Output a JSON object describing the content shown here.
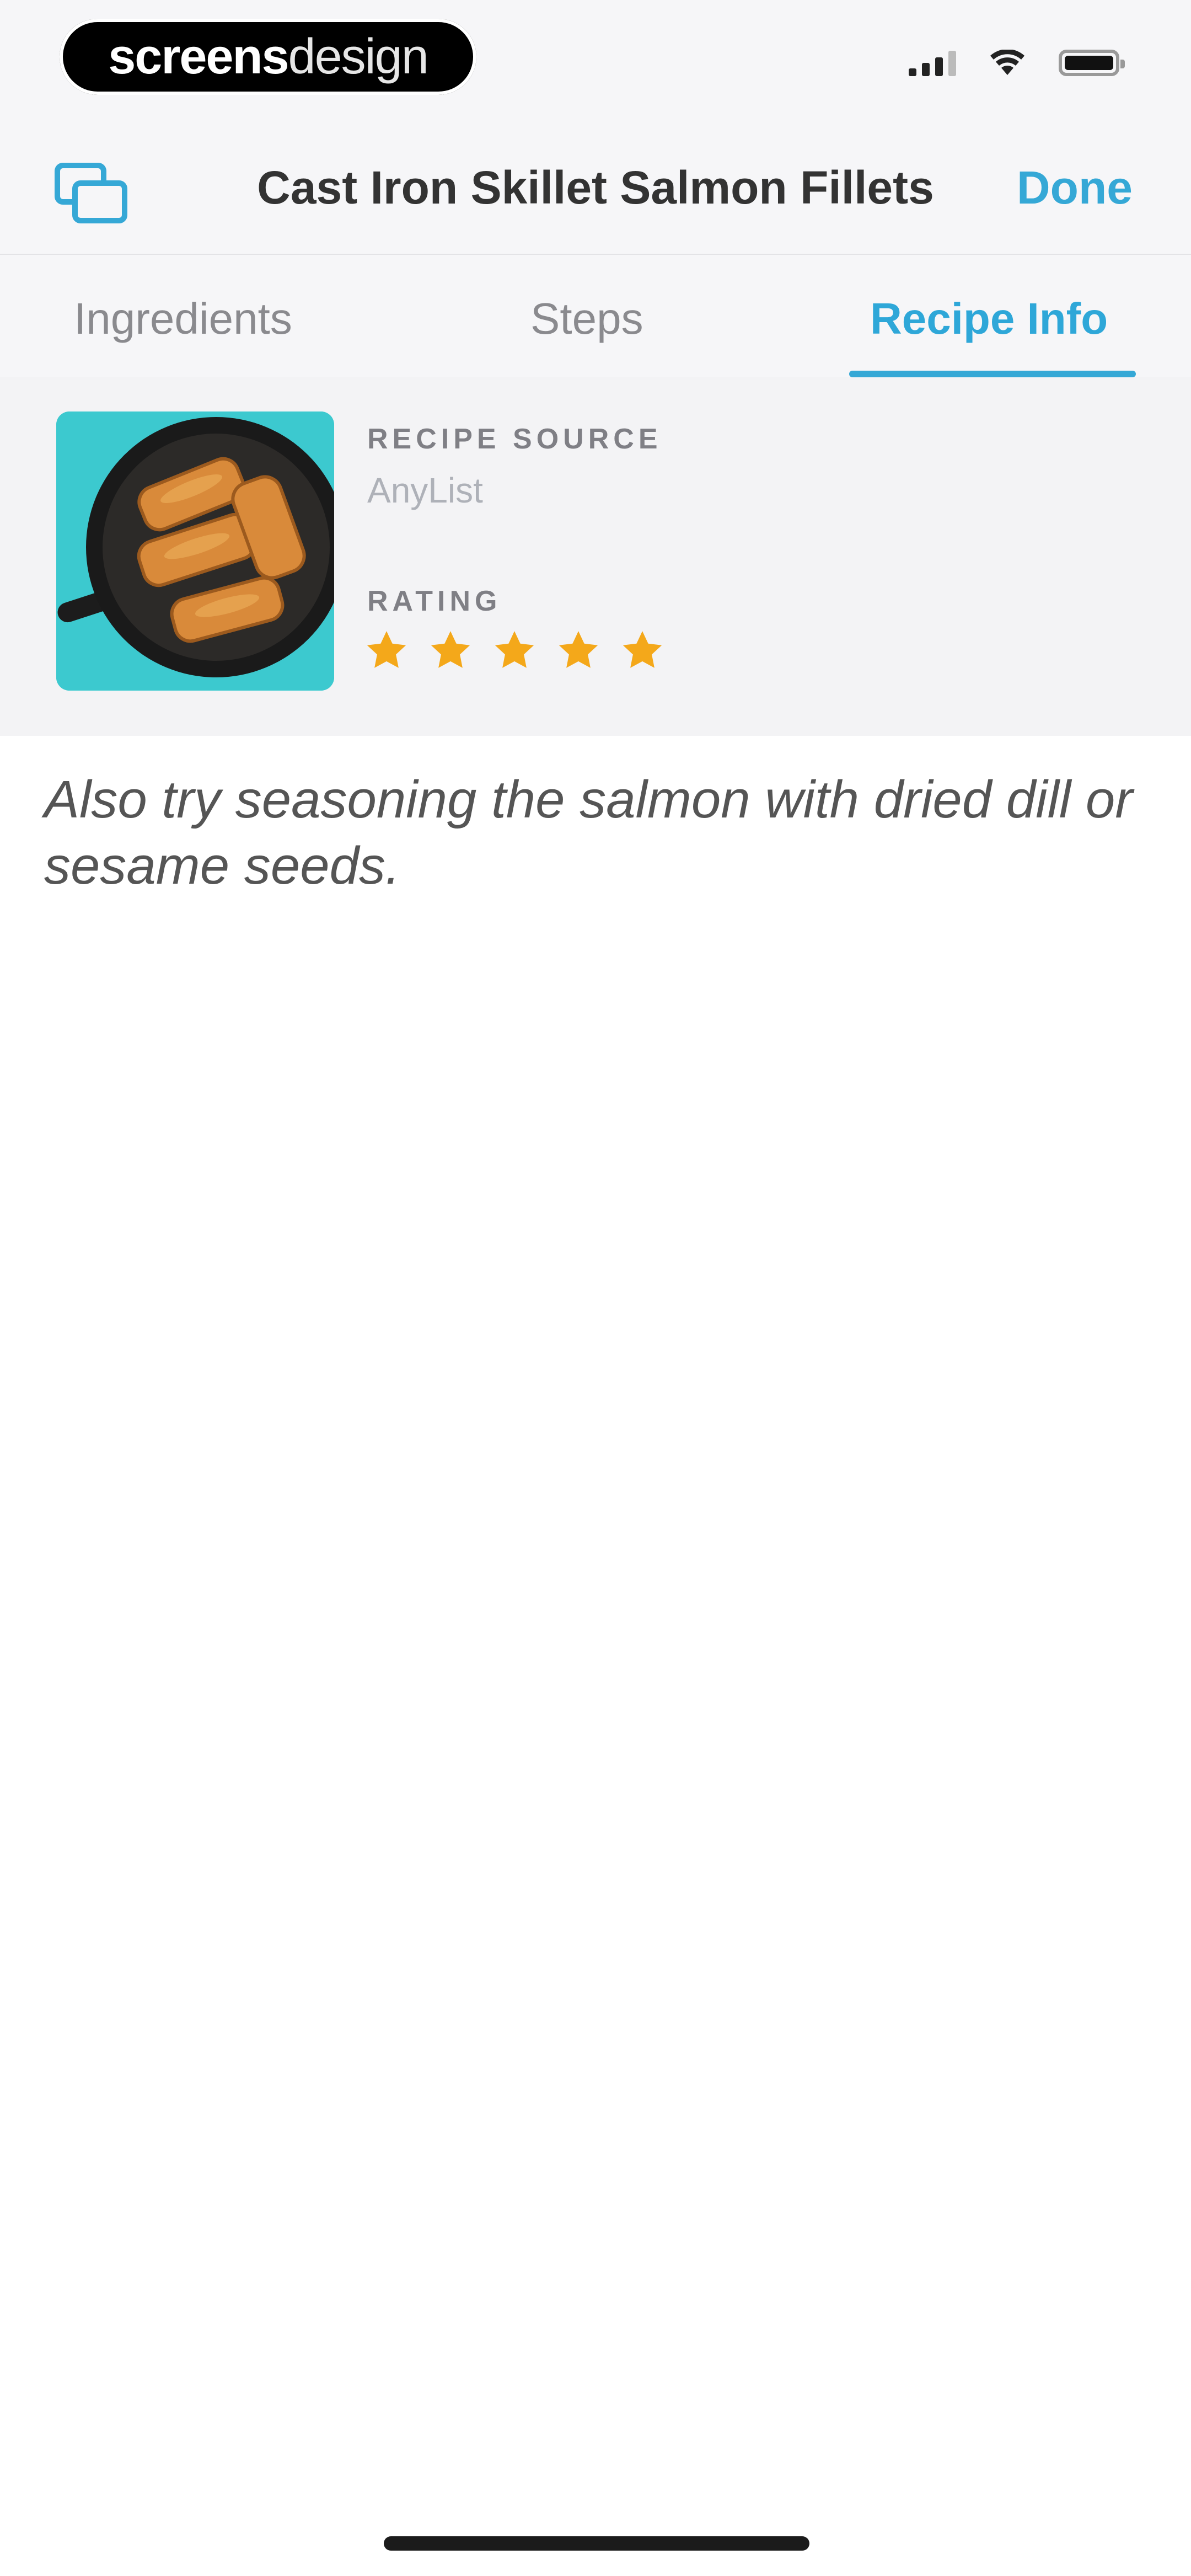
{
  "status_bar": {
    "brand_bold": "screens",
    "brand_thin": "design"
  },
  "nav": {
    "title": "Cast Iron Skillet Salmon Fillets",
    "done_label": "Done",
    "icon": "copy-windows-icon"
  },
  "tabs": [
    {
      "label": "Ingredients",
      "active": false
    },
    {
      "label": "Steps",
      "active": false
    },
    {
      "label": "Recipe Info",
      "active": true
    }
  ],
  "recipe_info": {
    "source_label": "RECIPE SOURCE",
    "source_value": "AnyList",
    "rating_label": "RATING",
    "rating": 5,
    "rating_max": 5,
    "star_color": "#f4a81a"
  },
  "note": "Also try seasoning the salmon with dried dill or sesame seeds.",
  "colors": {
    "accent": "#35a8d6",
    "photo_background": "#3cc9cf"
  }
}
